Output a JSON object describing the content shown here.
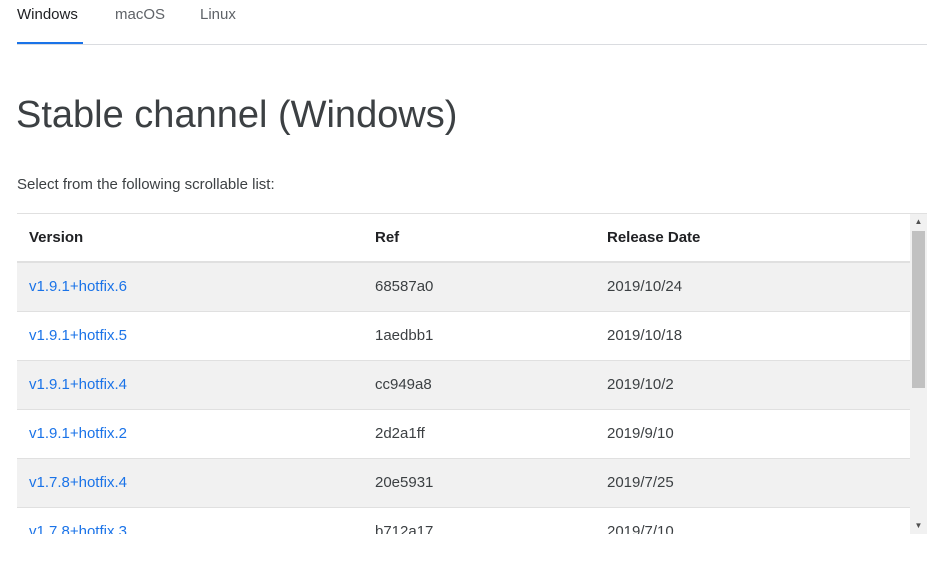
{
  "tabs": [
    {
      "label": "Windows",
      "active": true
    },
    {
      "label": "macOS",
      "active": false
    },
    {
      "label": "Linux",
      "active": false
    }
  ],
  "page_title": "Stable channel (Windows)",
  "intro_text": "Select from the following scrollable list:",
  "table": {
    "headers": {
      "version": "Version",
      "ref": "Ref",
      "date": "Release Date"
    },
    "rows": [
      {
        "version": "v1.9.1+hotfix.6",
        "ref": "68587a0",
        "date": "2019/10/24"
      },
      {
        "version": "v1.9.1+hotfix.5",
        "ref": "1aedbb1",
        "date": "2019/10/18"
      },
      {
        "version": "v1.9.1+hotfix.4",
        "ref": "cc949a8",
        "date": "2019/10/2"
      },
      {
        "version": "v1.9.1+hotfix.2",
        "ref": "2d2a1ff",
        "date": "2019/9/10"
      },
      {
        "version": "v1.7.8+hotfix.4",
        "ref": "20e5931",
        "date": "2019/7/25"
      },
      {
        "version": "v1.7.8+hotfix.3",
        "ref": "b712a17",
        "date": "2019/7/10"
      }
    ]
  },
  "scrollbar": {
    "position_fraction": 0,
    "visible_fraction": 0.55
  },
  "colors": {
    "accent": "#1a73e8",
    "stripe": "#f1f1f1",
    "divider": "#e0e0e0"
  },
  "icons": {
    "scroll_up": "triangle-up-icon",
    "scroll_down": "triangle-down-icon"
  }
}
